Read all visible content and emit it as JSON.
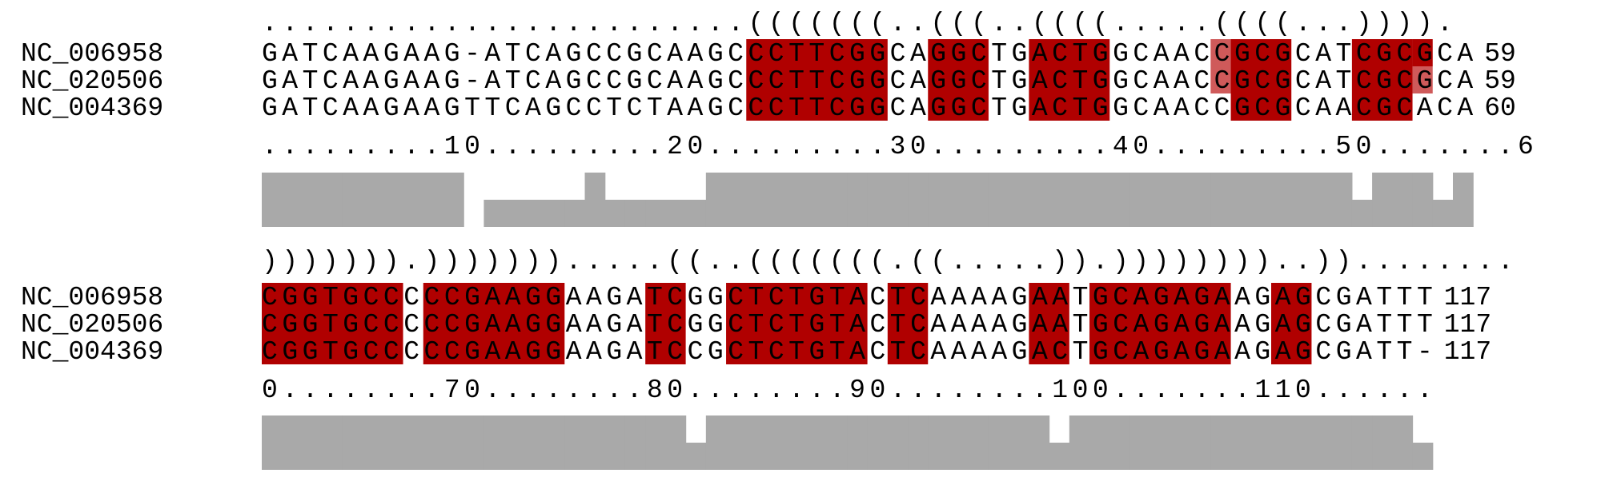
{
  "colors": {
    "background": "#ffffff",
    "paired": "#b00000",
    "compatible": "#cf5a5a",
    "conservation": "#a9a9a9",
    "text": "#000000"
  },
  "blocks": [
    {
      "structure": "........................(((((((..(((..((((.....((((...)))).",
      "rows": [
        {
          "name": "NC_006958",
          "seq": "GATCAAGAAG-ATCAGCCGCAAGCCCTTCGGCAGGCTGACTGGCAACCGCGCATCGCGCA",
          "end": "59"
        },
        {
          "name": "NC_020506",
          "seq": "GATCAAGAAG-ATCAGCCGCAAGCCCTTCGGCAGGCTGACTGGCAACCGCGCATCGCGCA",
          "end": "59"
        },
        {
          "name": "NC_004369",
          "seq": "GATCAAGAAGTTCAGCCTCTAAGCCCTTCGGCAGGCTGACTGGCAACCGCGCAACGCACA",
          "end": "60"
        }
      ],
      "ruler": ".........10.........20.........30.........40.........50.......6",
      "highlights": [
        {
          "start": 24,
          "end": 30,
          "rows": [
            0,
            1,
            2
          ],
          "kind": "paired"
        },
        {
          "start": 33,
          "end": 35,
          "rows": [
            0,
            1,
            2
          ],
          "kind": "paired"
        },
        {
          "start": 38,
          "end": 41,
          "rows": [
            0,
            1,
            2
          ],
          "kind": "paired"
        },
        {
          "start": 47,
          "end": 47,
          "rows": [
            0,
            1
          ],
          "kind": "compatible"
        },
        {
          "start": 48,
          "end": 50,
          "rows": [
            0,
            1
          ],
          "kind": "paired"
        },
        {
          "start": 48,
          "end": 50,
          "rows": [
            2
          ],
          "kind": "paired"
        },
        {
          "start": 54,
          "end": 56,
          "rows": [
            0,
            1,
            2
          ],
          "kind": "paired"
        },
        {
          "start": 57,
          "end": 57,
          "rows": [
            0
          ],
          "kind": "paired"
        },
        {
          "start": 57,
          "end": 57,
          "rows": [
            1
          ],
          "kind": "compatible"
        }
      ],
      "conservation": [
        1,
        1,
        1,
        1,
        1,
        1,
        1,
        1,
        1,
        1,
        0,
        0.5,
        0.5,
        0.5,
        0.5,
        0.5,
        1,
        0.5,
        0.5,
        0.5,
        0.5,
        0.5,
        1,
        1,
        1,
        1,
        1,
        1,
        1,
        1,
        1,
        1,
        1,
        1,
        1,
        1,
        1,
        1,
        1,
        1,
        1,
        1,
        1,
        1,
        1,
        1,
        1,
        1,
        1,
        1,
        1,
        1,
        1,
        1,
        0.5,
        1,
        1,
        1,
        0.5,
        1
      ]
    },
    {
      "structure": "))))))).))))))).....((..(((((((.((.....)).))))))))..))........",
      "rows": [
        {
          "name": "NC_006958",
          "seq": "CGGTGCCCCCGAAGGAAGATCGGCTCTGTACTCAAAAGAATGCAGAGAAGAGCGATTT",
          "end": "117"
        },
        {
          "name": "NC_020506",
          "seq": "CGGTGCCCCCGAAGGAAGATCGGCTCTGTACTCAAAAGAATGCAGAGAAGAGCGATTT",
          "end": "117"
        },
        {
          "name": "NC_004369",
          "seq": "CGGTGCCCCCGAAGGAAGATCCGCTCTGTACTCAAAAGACTGCAGAGAAGAGCGATT-",
          "end": "117"
        }
      ],
      "ruler": "0........70........80........90........100.......110......",
      "highlights": [
        {
          "start": 0,
          "end": 6,
          "rows": [
            0,
            1,
            2
          ],
          "kind": "paired"
        },
        {
          "start": 8,
          "end": 14,
          "rows": [
            0,
            1,
            2
          ],
          "kind": "paired"
        },
        {
          "start": 19,
          "end": 20,
          "rows": [
            0,
            1,
            2
          ],
          "kind": "paired"
        },
        {
          "start": 23,
          "end": 29,
          "rows": [
            0,
            1,
            2
          ],
          "kind": "paired"
        },
        {
          "start": 31,
          "end": 32,
          "rows": [
            0,
            1,
            2
          ],
          "kind": "paired"
        },
        {
          "start": 38,
          "end": 39,
          "rows": [
            0,
            1,
            2
          ],
          "kind": "paired"
        },
        {
          "start": 41,
          "end": 47,
          "rows": [
            0,
            1,
            2
          ],
          "kind": "paired"
        },
        {
          "start": 50,
          "end": 51,
          "rows": [
            0,
            1,
            2
          ],
          "kind": "paired"
        }
      ],
      "conservation": [
        1,
        1,
        1,
        1,
        1,
        1,
        1,
        1,
        1,
        1,
        1,
        1,
        1,
        1,
        1,
        1,
        1,
        1,
        1,
        1,
        1,
        0.5,
        1,
        1,
        1,
        1,
        1,
        1,
        1,
        1,
        1,
        1,
        1,
        1,
        1,
        1,
        1,
        1,
        1,
        0.5,
        1,
        1,
        1,
        1,
        1,
        1,
        1,
        1,
        1,
        1,
        1,
        1,
        1,
        1,
        1,
        1,
        1,
        0.5
      ]
    }
  ]
}
